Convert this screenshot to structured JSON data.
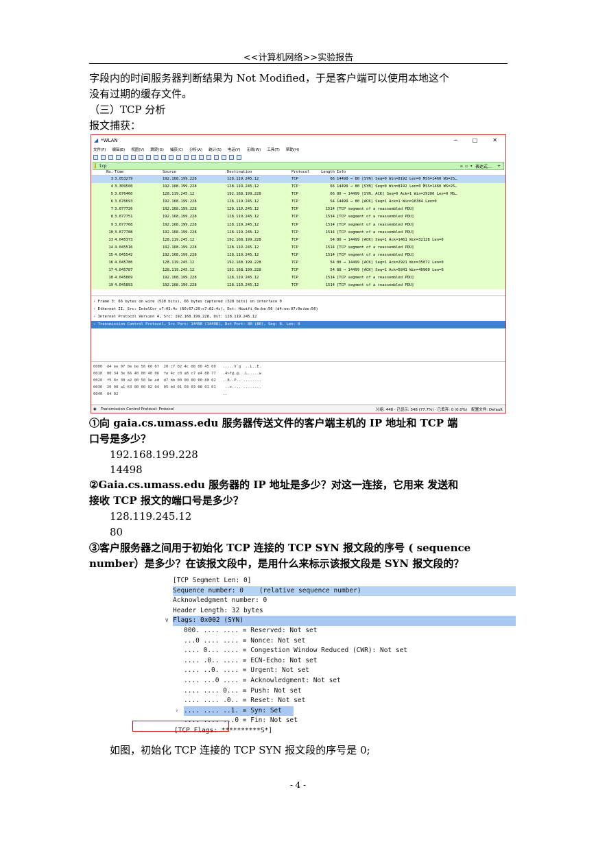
{
  "header": {
    "title": "<<计算机网络>>实验报告"
  },
  "intro": {
    "line1": "字段内的时间服务器判断结果为 Not Modified，于是客户端可以使用本地这个",
    "line2": "没有过期的缓存文件。",
    "section": "（三）TCP 分析",
    "capture_label": "报文捕获："
  },
  "wireshark": {
    "window_title": "*WLAN",
    "controls": [
      "─",
      "□",
      "✕"
    ],
    "menu": [
      "文件(F)",
      "编辑(E)",
      "视图(V)",
      "跳转(G)",
      "捕获(C)",
      "分析(A)",
      "统计(S)",
      "电话(Y)",
      "无线(W)",
      "工具(T)",
      "帮助(H)"
    ],
    "filter": {
      "value": "tcp",
      "expression": "表达式…",
      "plus": "+"
    },
    "columns": [
      "No.",
      "Time",
      "Source",
      "Destination",
      "Protocol",
      "Length",
      "Info"
    ],
    "packets": [
      [
        "3",
        "3.053279",
        "192.168.199.228",
        "128.119.245.12",
        "TCP",
        "66",
        "14498 → 80 [SYN] Seq=0 Win=8192 Len=0 MSS=1460 WS=25…"
      ],
      [
        "4",
        "3.309500",
        "192.168.199.228",
        "128.119.245.12",
        "TCP",
        "66",
        "14499 → 80 [SYN] Seq=0 Win=8192 Len=0 MSS=1460 WS=25…"
      ],
      [
        "5",
        "3.676460",
        "128.119.245.12",
        "192.168.199.228",
        "TCP",
        "66",
        "80 → 14499 [SYN, ACK] Seq=0 Ack=1 Win=29200 Len=0 MS…"
      ],
      [
        "6",
        "3.676693",
        "192.168.199.228",
        "128.119.245.12",
        "TCP",
        "54",
        "14499 → 80 [ACK] Seq=1 Ack=1 Win=16384 Len=0"
      ],
      [
        "7",
        "3.677726",
        "192.168.199.228",
        "128.119.245.12",
        "TCP",
        "1514",
        "[TCP segment of a reassembled PDU]"
      ],
      [
        "8",
        "3.677751",
        "192.168.199.228",
        "128.119.245.12",
        "TCP",
        "1514",
        "[TCP segment of a reassembled PDU]"
      ],
      [
        "9",
        "3.677768",
        "192.168.199.228",
        "128.119.245.12",
        "TCP",
        "1514",
        "[TCP segment of a reassembled PDU]"
      ],
      [
        "10",
        "3.677788",
        "192.168.199.228",
        "128.119.245.12",
        "TCP",
        "1514",
        "[TCP segment of a reassembled PDU]"
      ],
      [
        "13",
        "4.045373",
        "128.119.245.12",
        "192.168.199.228",
        "TCP",
        "54",
        "80 → 14499 [ACK] Seq=1 Ack=1461 Win=32128 Len=0"
      ],
      [
        "14",
        "4.045516",
        "192.168.199.228",
        "128.119.245.12",
        "TCP",
        "1514",
        "[TCP segment of a reassembled PDU]"
      ],
      [
        "15",
        "4.045542",
        "192.168.199.228",
        "128.119.245.12",
        "TCP",
        "1514",
        "[TCP segment of a reassembled PDU]"
      ],
      [
        "16",
        "4.045786",
        "128.119.245.12",
        "192.168.199.228",
        "TCP",
        "54",
        "80 → 14499 [ACK] Seq=1 Ack=2921 Win=35072 Len=0"
      ],
      [
        "17",
        "4.045787",
        "128.119.245.12",
        "192.168.199.228",
        "TCP",
        "54",
        "80 → 14499 [ACK] Seq=1 Ack=5841 Win=40960 Len=0"
      ],
      [
        "18",
        "4.045869",
        "192.168.199.228",
        "128.119.245.12",
        "TCP",
        "1514",
        "[TCP segment of a reassembled PDU]"
      ],
      [
        "19",
        "4.045893",
        "192.168.199.228",
        "128.119.245.12",
        "TCP",
        "1514",
        "[TCP segment of a reassembled PDU]"
      ]
    ],
    "details": [
      "› Frame 3: 66 bytes on wire (528 bits), 66 bytes captured (528 bits) on interface 0",
      "› Ethernet II, Src: IntelCor_c7:02:4c (60:67:20:c7:02:4c), Dst: Hiwifi_0e:be:56 (d4:ee:07:0e:be:56)",
      "› Internet Protocol Version 4, Src: 192.168.199.228, Dst: 128.119.245.12",
      "› Transmission Control Protocol, Src Port: 14498 (14498), Dst Port: 80 (80), Seq: 0, Len: 0"
    ],
    "hex": [
      "0000  d4 ee 07 0e be 56 60 67  20 c7 02 4c 08 00 45 00   .....V`g  ..L..E.",
      "0010  00 34 3e 66 40 00 40 06  fe 4c c0 a8 c7 e4 80 77   .4>f@.@. .L.....w",
      "0020  f5 0c 38 a2 00 50 9e ed  d7 bb 00 00 00 00 80 02   ..8..P.. ........",
      "0030  20 00 a1 63 00 00 02 04  05 b4 01 03 03 08 01 01    ..c.... ........",
      "0040  04 02                                              .."
    ],
    "status": {
      "left": "Transmission Control Protocol: Protocol",
      "counts": "分组: 448 · 已显示: 348 (77.7%) · 已丢弃: 0 (0.0%)",
      "profile": "配置文件: Default"
    }
  },
  "qa": {
    "q1a": "①向 gaia.cs.umass.edu 服务器传送文件的客户端主机的 IP 地址和 TCP 端",
    "q1b": "口号是多少？",
    "a1a": "192.168.199.228",
    "a1b": "14498",
    "q2a": "②Gaia.cs.umass.edu 服务器的 IP 地址是多少？对这一连接，它用来 发送和",
    "q2b": "接收 TCP 报文的端口号是多少？",
    "a2a": "128.119.245.12",
    "a2b": "80",
    "q3a": "③客户服务器之间用于初始化 TCP 连接的 TCP SYN 报文段的序号 ( sequence",
    "q3b": "number）是多少？在该报文段中，是用什么来标示该报文段是 SYN 报文段的？"
  },
  "flags_detail": {
    "lines": [
      "[TCP Segment Len: 0]",
      "Sequence number: 0    (relative sequence number)",
      "Acknowledgment number: 0",
      "Header Length: 32 bytes",
      "Flags: 0x002 (SYN)",
      "000. .... .... = Reserved: Not set",
      "...0 .... .... = Nonce: Not set",
      ".... 0... .... = Congestion Window Reduced (CWR): Not set",
      ".... .0.. .... = ECN-Echo: Not set",
      ".... ..0. .... = Urgent: Not set",
      ".... ...0 .... = Acknowledgment: Not set",
      ".... .... 0... = Push: Not set",
      ".... .... .0.. = Reset: Not set",
      ".... .... ..1. = Syn: Set",
      ".... .... ...0 = Fin: Not set",
      "[TCP Flags: **********S*]"
    ]
  },
  "conclusion": "如图，初始化 TCP 连接的 TCP SYN 报文段的序号是 0;",
  "footer": {
    "page": "- 4 -"
  }
}
